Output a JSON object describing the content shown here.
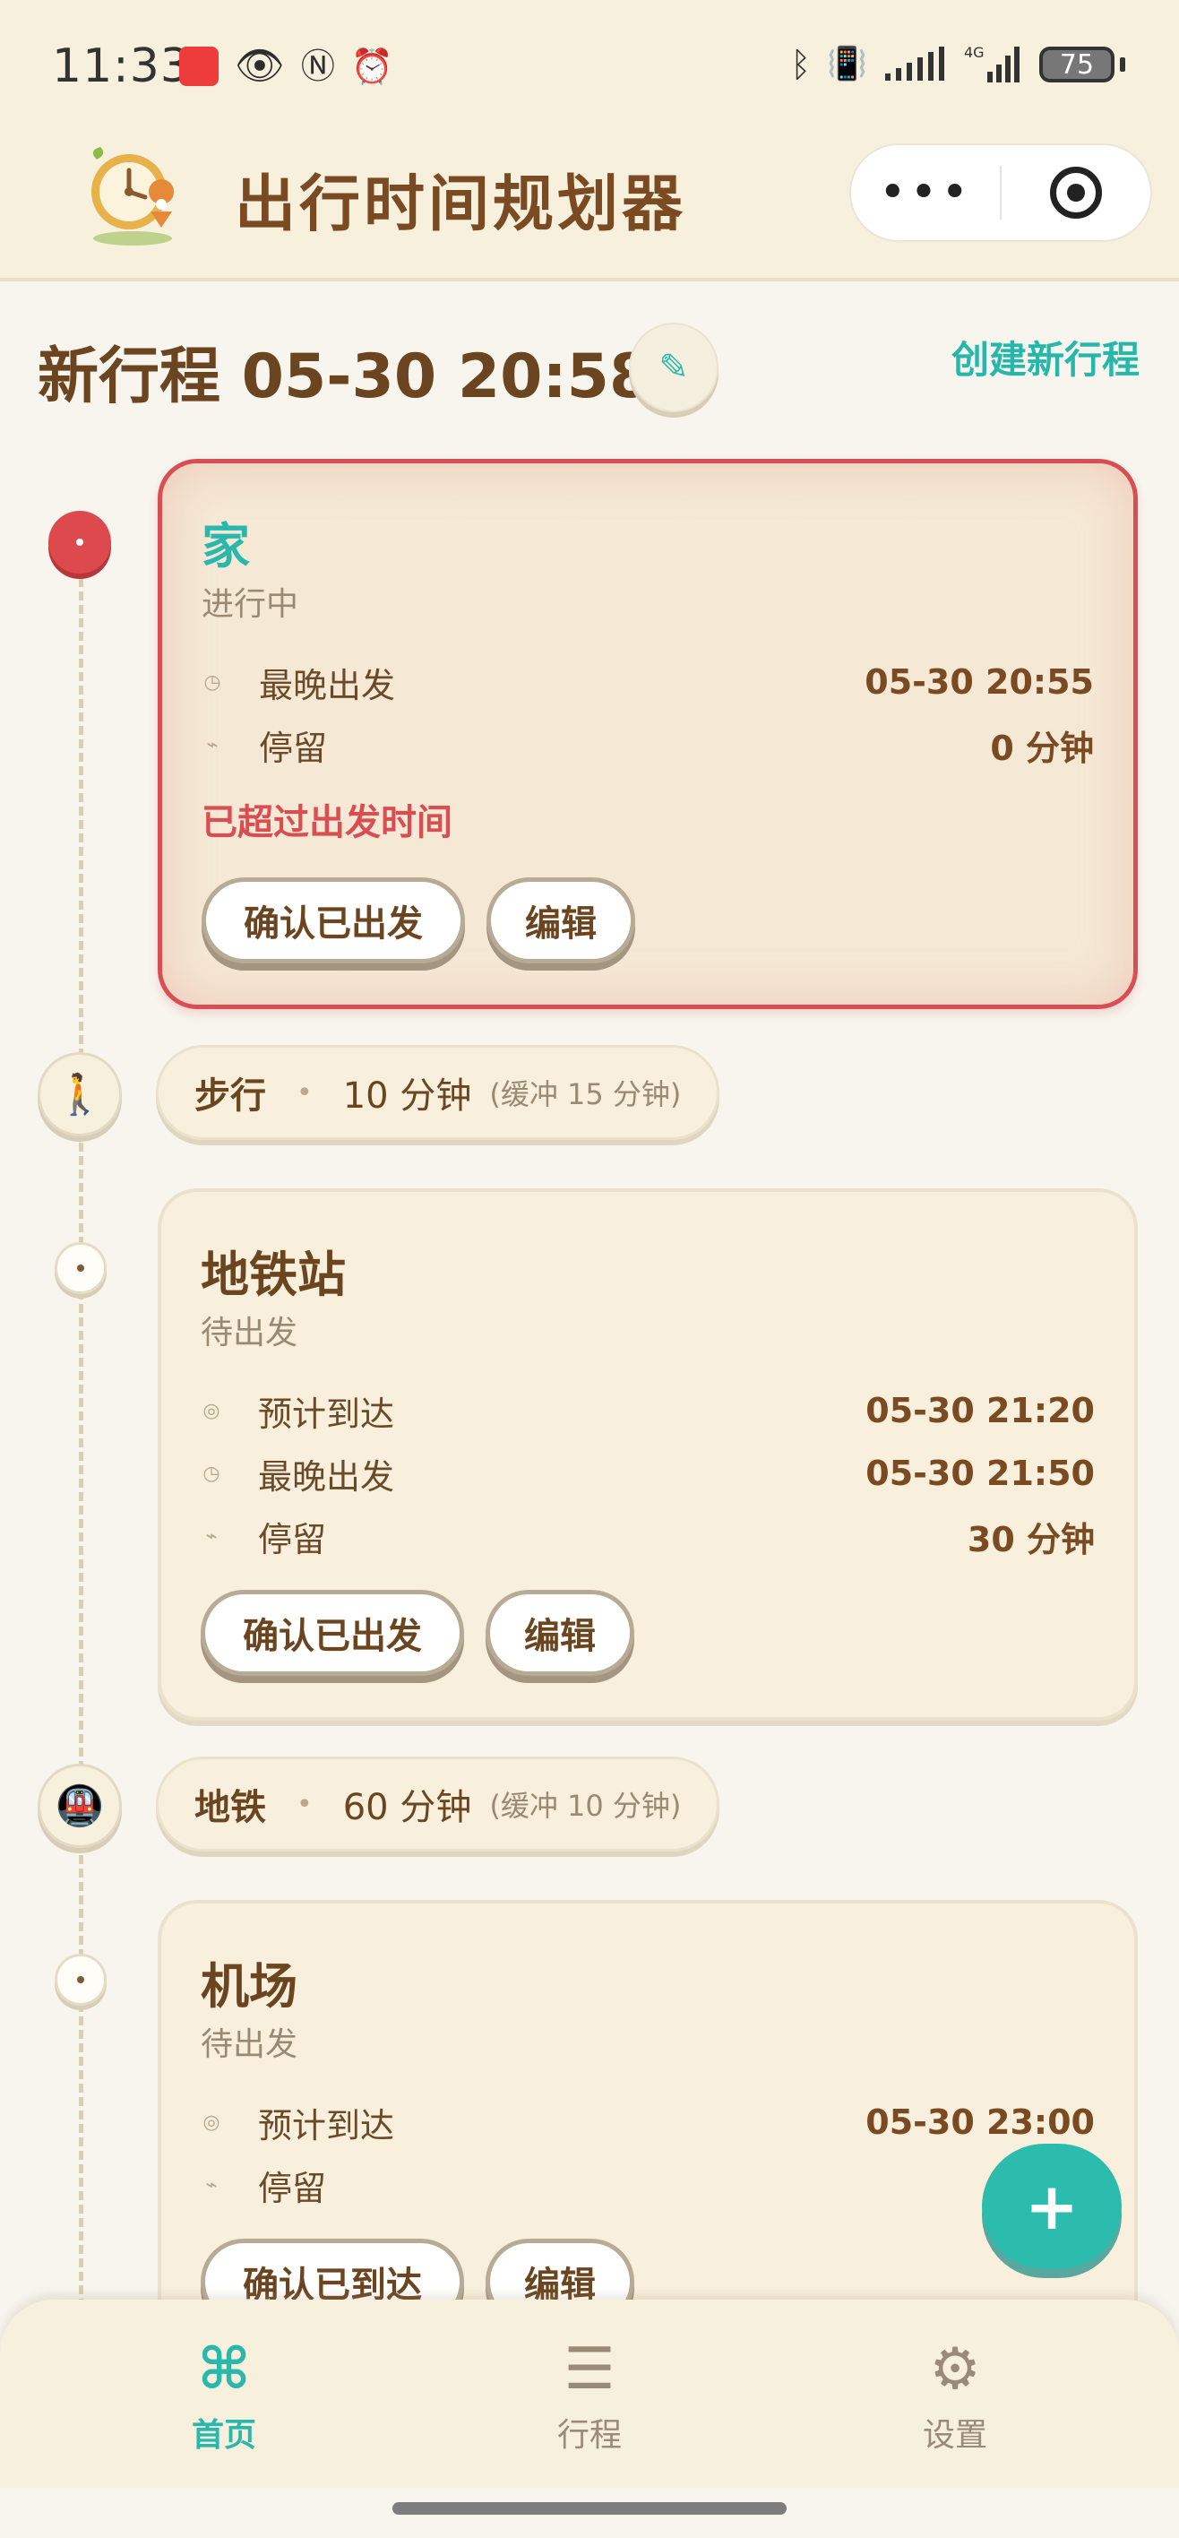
{
  "status_bar": {
    "time": "11:33",
    "left_icons": [
      "huawei-app-icon",
      "eye-icon",
      "nfc-icon",
      "alarm-icon"
    ],
    "right_icons": [
      "bluetooth-icon",
      "vibrate-icon",
      "signal-icon",
      "4g-signal-icon"
    ],
    "battery": "75"
  },
  "header": {
    "title": "出行时间规划器",
    "logo_icon": "clock-location-logo",
    "more_glyph": "•••",
    "target_icon": "target-icon"
  },
  "trip": {
    "title": "新行程 05-30 20:58",
    "edit_glyph": "✎",
    "create_label": "创建新行程"
  },
  "stops": [
    {
      "name": "家",
      "status": "进行中",
      "rows": [
        {
          "icon": "clock-icon",
          "glyph": "◷",
          "label": "最晚出发",
          "value": "05-30 20:55"
        },
        {
          "icon": "stay-icon",
          "glyph": "⌁",
          "label": "停留",
          "value": "0 分钟"
        }
      ],
      "warning": "已超过出发时间",
      "primary_btn": "确认已出发",
      "edit_btn": "编辑",
      "accent": "#d94e52"
    },
    {
      "name": "地铁站",
      "status": "待出发",
      "rows": [
        {
          "icon": "arrival-icon",
          "glyph": "◎",
          "label": "预计到达",
          "value": "05-30 21:20"
        },
        {
          "icon": "clock-icon",
          "glyph": "◷",
          "label": "最晚出发",
          "value": "05-30 21:50"
        },
        {
          "icon": "stay-icon",
          "glyph": "⌁",
          "label": "停留",
          "value": "30 分钟"
        }
      ],
      "primary_btn": "确认已出发",
      "edit_btn": "编辑"
    },
    {
      "name": "机场",
      "status": "待出发",
      "rows": [
        {
          "icon": "arrival-icon",
          "glyph": "◎",
          "label": "预计到达",
          "value": "05-30 23:00"
        },
        {
          "icon": "stay-icon",
          "glyph": "⌁",
          "label": "停留",
          "value": ""
        }
      ],
      "primary_btn": "确认已到达",
      "edit_btn": "编辑"
    }
  ],
  "legs": [
    {
      "icon": "walking-icon",
      "glyph": "🚶",
      "mode": "步行",
      "sep": "•",
      "duration": "10 分钟",
      "buffer": "(缓冲 15 分钟)"
    },
    {
      "icon": "subway-icon",
      "glyph": "🚇",
      "mode": "地铁",
      "sep": "•",
      "duration": "60 分钟",
      "buffer": "(缓冲 10 分钟)"
    }
  ],
  "fab": {
    "label": "+"
  },
  "nav": [
    {
      "icon": "command-icon",
      "glyph": "⌘",
      "label": "首页",
      "active": true
    },
    {
      "icon": "list-icon",
      "glyph": "☰",
      "label": "行程",
      "active": false
    },
    {
      "icon": "gear-icon",
      "glyph": "⚙",
      "label": "设置",
      "active": false
    }
  ],
  "colors": {
    "accent": "#2bb8ac",
    "danger": "#d94e52",
    "brown": "#6b4520",
    "card_bg": "#f8f0dc"
  }
}
